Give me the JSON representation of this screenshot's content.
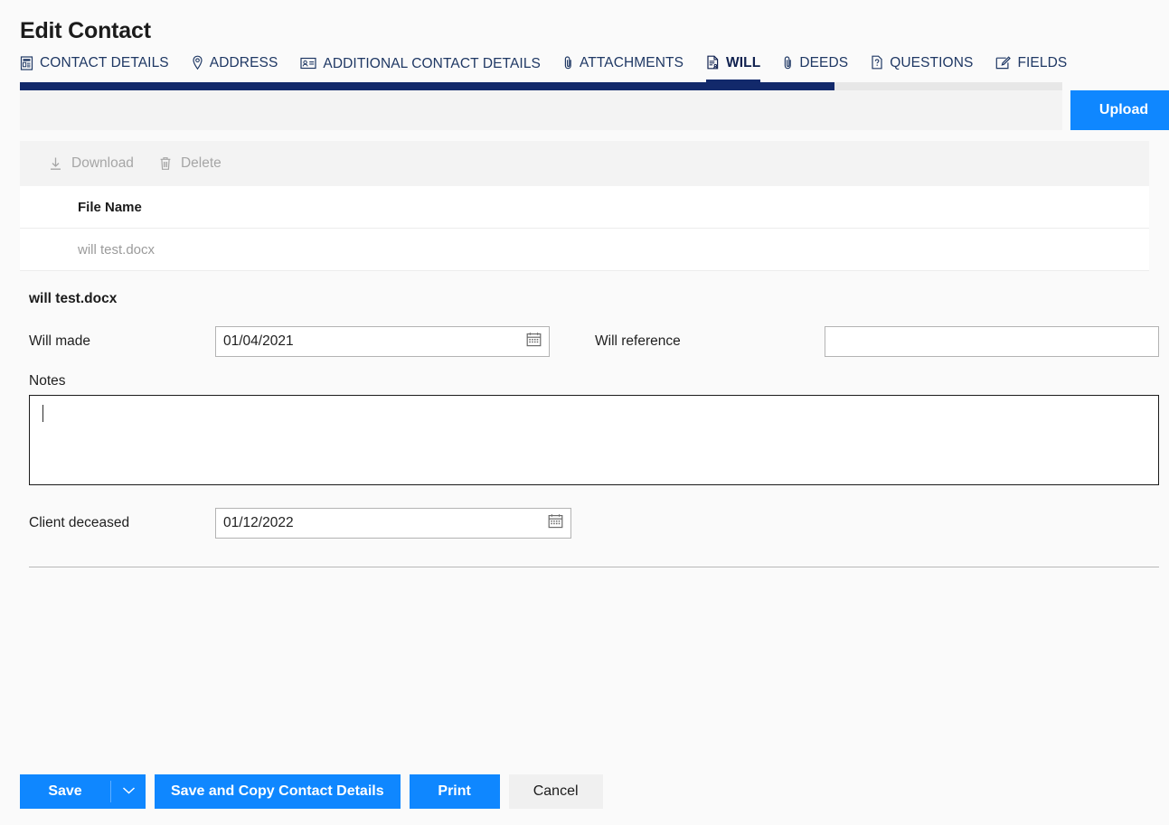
{
  "header": {
    "title": "Edit Contact"
  },
  "tabs": [
    {
      "label": "CONTACT DETAILS",
      "icon": "contact-card-icon",
      "active": false
    },
    {
      "label": "ADDRESS",
      "icon": "map-pin-icon",
      "active": false
    },
    {
      "label": "ADDITIONAL CONTACT DETAILS",
      "icon": "id-card-icon",
      "active": false
    },
    {
      "label": "ATTACHMENTS",
      "icon": "paperclip-icon",
      "active": false
    },
    {
      "label": "WILL",
      "icon": "document-person-icon",
      "active": true
    },
    {
      "label": "DEEDS",
      "icon": "paperclip-icon",
      "active": false
    },
    {
      "label": "QUESTIONS",
      "icon": "document-question-icon",
      "active": false
    },
    {
      "label": "FIELDS",
      "icon": "edit-pencil-icon",
      "active": false
    }
  ],
  "progress": {
    "percent": 78,
    "fill_color": "#12296b",
    "track_color": "#e7e7e7"
  },
  "upload": {
    "filename_value": "",
    "filename_placeholder": "",
    "button_label": "Upload",
    "button_color": "#0f87ff"
  },
  "toolbar": {
    "download_label": "Download",
    "delete_label": "Delete",
    "disabled_color": "#a6a6a6"
  },
  "file_table": {
    "columns": [
      "File Name"
    ],
    "rows": [
      {
        "file_name": "will test.docx"
      }
    ]
  },
  "detail": {
    "heading": "will test.docx",
    "will_made": {
      "label": "Will made",
      "value": "01/04/2021",
      "icon": "calendar-icon"
    },
    "will_reference": {
      "label": "Will reference",
      "value": "",
      "placeholder": ""
    },
    "notes": {
      "label": "Notes",
      "value": "",
      "placeholder": "",
      "focused": true
    },
    "client_deceased": {
      "label": "Client deceased",
      "value": "01/12/2022",
      "icon": "calendar-icon"
    }
  },
  "footer": {
    "save_label": "Save",
    "save_dropdown_icon": "chevron-down-icon",
    "save_copy_label": "Save and Copy Contact Details",
    "print_label": "Print",
    "cancel_label": "Cancel",
    "primary_color": "#0f87ff"
  }
}
